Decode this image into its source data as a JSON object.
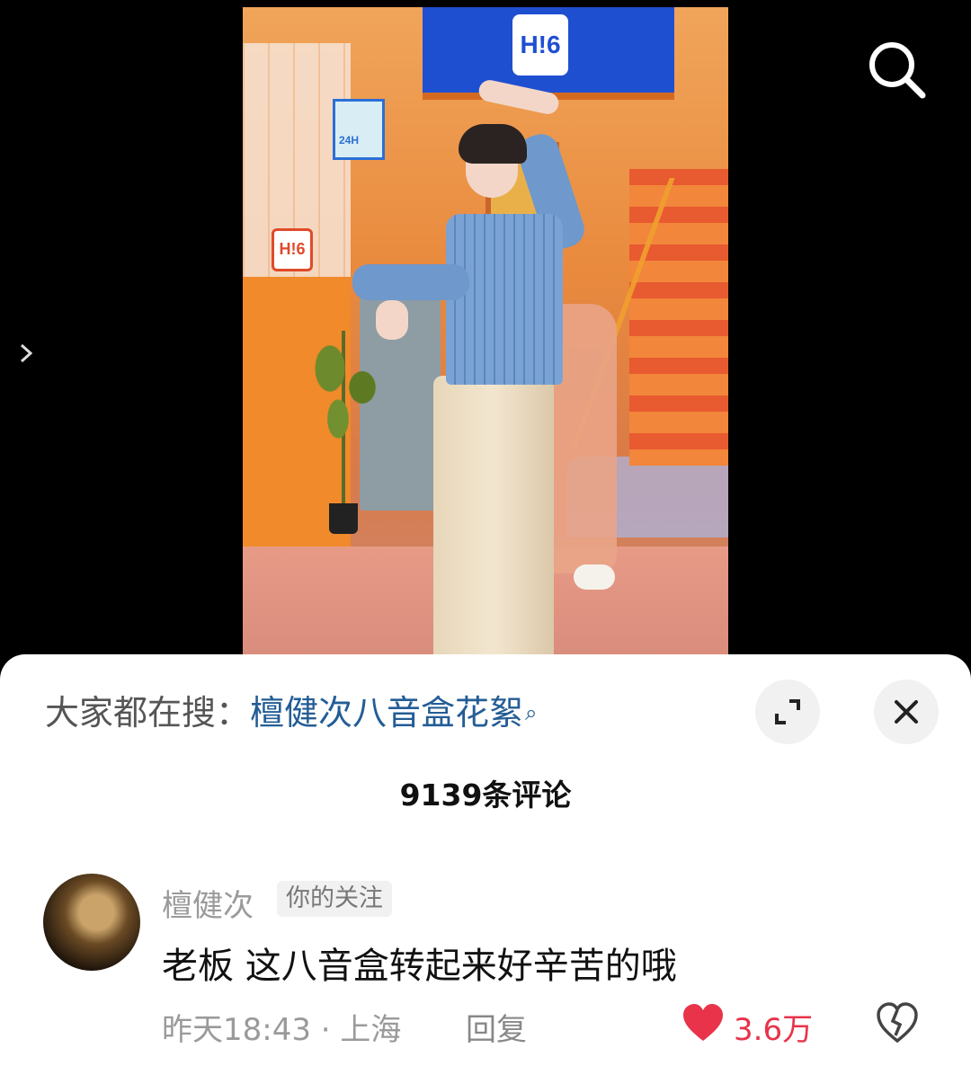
{
  "video": {
    "scene_logo": "H!6",
    "cube_label": "24H",
    "wall_sign": "H!6"
  },
  "comments_sheet": {
    "search_prefix": "大家都在搜：",
    "search_term": "檀健次八音盒花絮",
    "comment_count_label": "9139条评论",
    "comments": [
      {
        "username": "檀健次",
        "tag": "你的关注",
        "text": "老板 这八音盒转起来好辛苦的哦",
        "time": "昨天18:43",
        "separator": " · ",
        "location": "上海",
        "reply_label": "回复",
        "likes": "3.6万"
      }
    ]
  },
  "colors": {
    "accent_link": "#245d95",
    "like_red": "#e8334a",
    "muted": "#9a9a9a"
  },
  "icons": [
    "search-icon",
    "chevron-right-icon",
    "expand-icon",
    "close-icon",
    "heart-icon",
    "broken-heart-icon"
  ]
}
